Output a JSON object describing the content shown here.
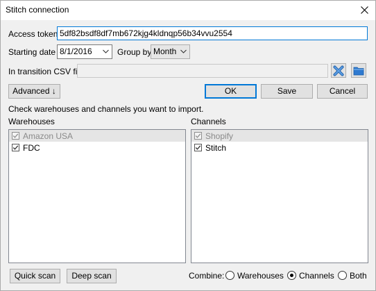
{
  "window": {
    "title": "Stitch connection"
  },
  "form": {
    "access_token_label": "Access token",
    "access_token_value": "5df82bsdf8df7mb672kjg4kldnqp56b34vvu2554",
    "starting_date_label": "Starting date",
    "starting_date_value": "8/1/2016",
    "group_by_label": "Group by",
    "group_by_value": "Month",
    "csv_label": "In transition CSV file",
    "csv_value": ""
  },
  "buttons": {
    "advanced": "Advanced ↓",
    "ok": "OK",
    "save": "Save",
    "cancel": "Cancel",
    "quick_scan": "Quick scan",
    "deep_scan": "Deep scan"
  },
  "instruction": "Check warehouses and channels you want to import.",
  "warehouses": {
    "label": "Warehouses",
    "items": [
      {
        "name": "Amazon USA",
        "checked": true,
        "selected": true
      },
      {
        "name": "FDC",
        "checked": true,
        "selected": false
      }
    ]
  },
  "channels": {
    "label": "Channels",
    "items": [
      {
        "name": "Shopify",
        "checked": true,
        "selected": true
      },
      {
        "name": "Stitch",
        "checked": true,
        "selected": false
      }
    ]
  },
  "combine": {
    "label": "Combine:",
    "options": [
      {
        "label": "Warehouses",
        "selected": false
      },
      {
        "label": "Channels",
        "selected": true
      },
      {
        "label": "Both",
        "selected": false
      }
    ]
  },
  "colors": {
    "accent": "#0078d7",
    "window_bg": "#f0f0f0",
    "clear_icon": "#3b78c4",
    "folder_icon": "#2f7ad0"
  },
  "icons": {
    "close": "close-icon",
    "clear": "clear-x-icon",
    "browse": "folder-icon",
    "dropdown": "chevron-down-icon"
  }
}
